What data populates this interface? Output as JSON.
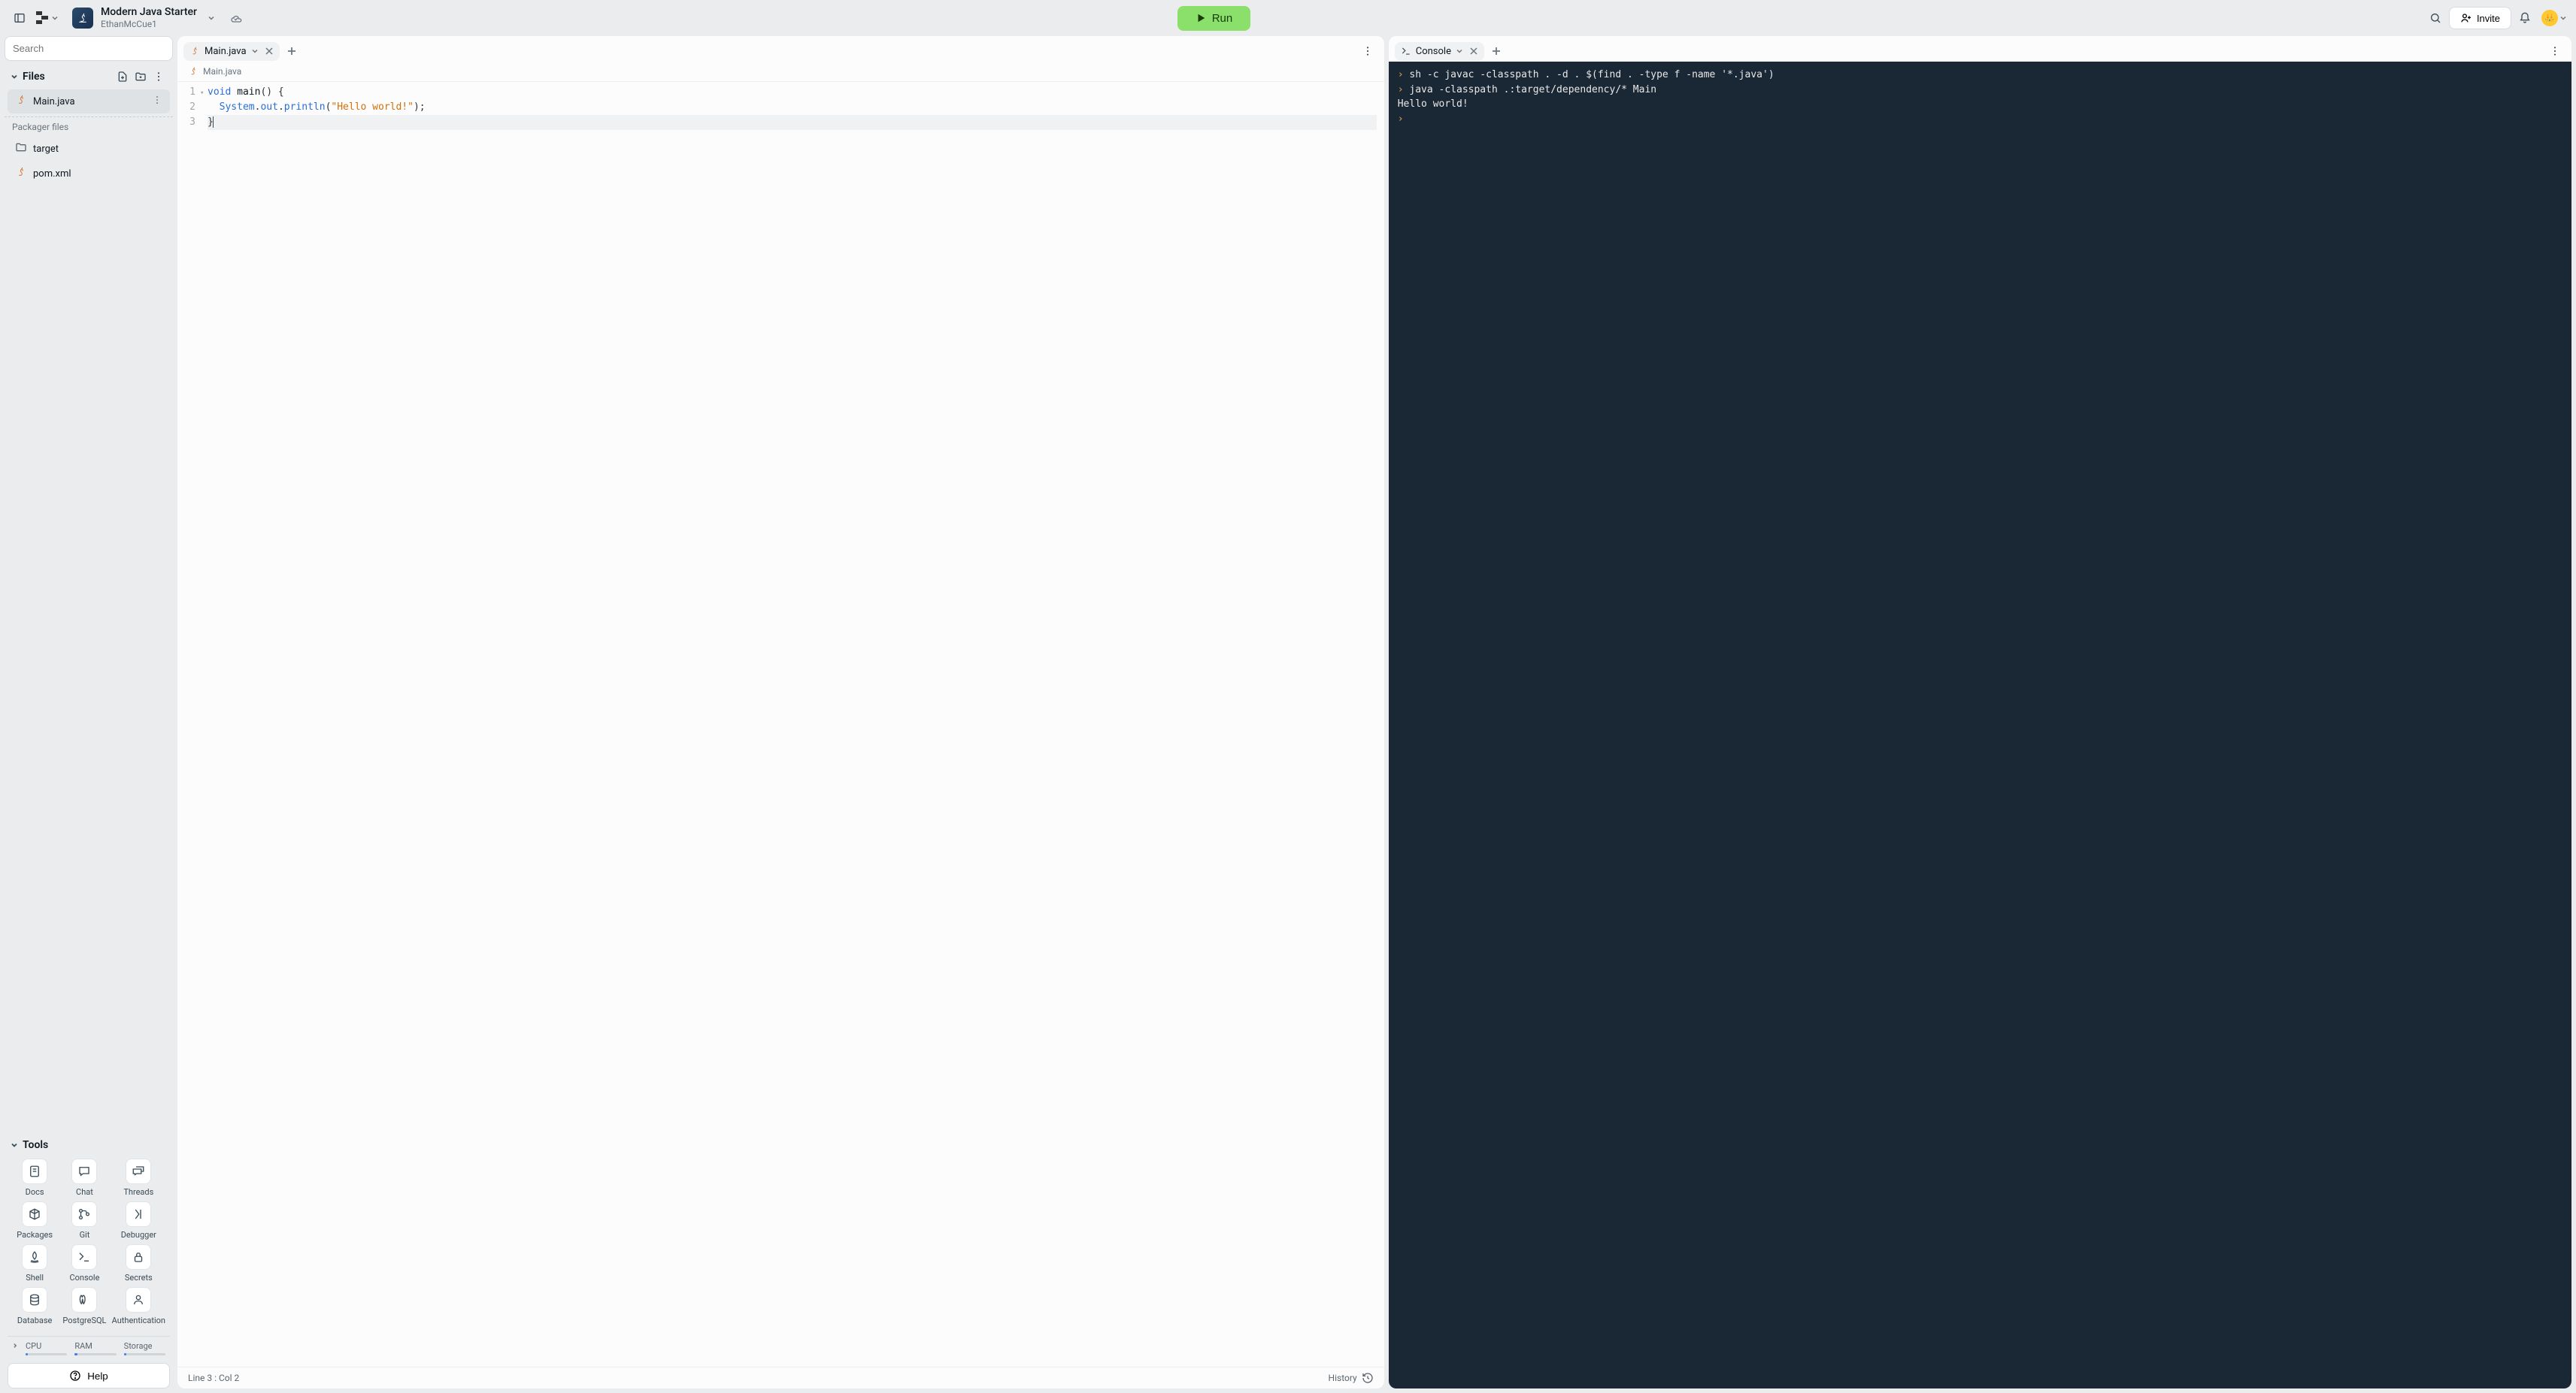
{
  "header": {
    "project_title": "Modern Java Starter",
    "project_owner": "EthanMcCue1",
    "run_label": "Run",
    "invite_label": "Invite"
  },
  "sidebar": {
    "search_placeholder": "Search",
    "files_label": "Files",
    "file_items": [
      {
        "name": "Main.java",
        "kind": "java",
        "active": true
      }
    ],
    "pkg_label": "Packager files",
    "pkg_items": [
      {
        "name": "target",
        "kind": "folder"
      },
      {
        "name": "pom.xml",
        "kind": "java"
      }
    ],
    "tools_label": "Tools",
    "tools": [
      {
        "name": "Docs",
        "icon": "docs"
      },
      {
        "name": "Chat",
        "icon": "chat"
      },
      {
        "name": "Threads",
        "icon": "threads"
      },
      {
        "name": "Packages",
        "icon": "packages"
      },
      {
        "name": "Git",
        "icon": "git"
      },
      {
        "name": "Debugger",
        "icon": "debugger"
      },
      {
        "name": "Shell",
        "icon": "shell"
      },
      {
        "name": "Console",
        "icon": "console"
      },
      {
        "name": "Secrets",
        "icon": "secrets"
      },
      {
        "name": "Database",
        "icon": "database"
      },
      {
        "name": "PostgreSQL",
        "icon": "postgresql"
      },
      {
        "name": "Authentication",
        "icon": "auth"
      }
    ],
    "resources": [
      {
        "label": "CPU"
      },
      {
        "label": "RAM"
      },
      {
        "label": "Storage"
      }
    ],
    "help_label": "Help"
  },
  "editor": {
    "tab_label": "Main.java",
    "breadcrumb": "Main.java",
    "code_lines": [
      {
        "num": "1",
        "tokens": [
          {
            "t": "void",
            "c": "kw"
          },
          {
            "t": " ",
            "c": ""
          },
          {
            "t": "main",
            "c": ""
          },
          {
            "t": "()",
            "c": "punc"
          },
          {
            "t": " {",
            "c": "punc"
          }
        ],
        "fold": true
      },
      {
        "num": "2",
        "tokens": [
          {
            "t": "  ",
            "c": ""
          },
          {
            "t": "System",
            "c": "kw"
          },
          {
            "t": ".",
            "c": "punc"
          },
          {
            "t": "out",
            "c": "kw"
          },
          {
            "t": ".",
            "c": "punc"
          },
          {
            "t": "println",
            "c": "kw"
          },
          {
            "t": "(",
            "c": "punc"
          },
          {
            "t": "\"Hello world!\"",
            "c": "str"
          },
          {
            "t": ");",
            "c": "punc"
          }
        ]
      },
      {
        "num": "3",
        "tokens": [
          {
            "t": "}",
            "c": "punc"
          }
        ],
        "cursor_after": true,
        "current": true
      }
    ],
    "status": "Line 3 : Col 2",
    "history_label": "History"
  },
  "console": {
    "tab_label": "Console",
    "output_lines": [
      {
        "prompt": true,
        "text": "sh -c javac -classpath . -d . $(find . -type f -name '*.java')"
      },
      {
        "prompt": true,
        "text": "java -classpath .:target/dependency/* Main"
      },
      {
        "prompt": false,
        "text": "Hello world!"
      },
      {
        "prompt": true,
        "text": ""
      }
    ]
  }
}
